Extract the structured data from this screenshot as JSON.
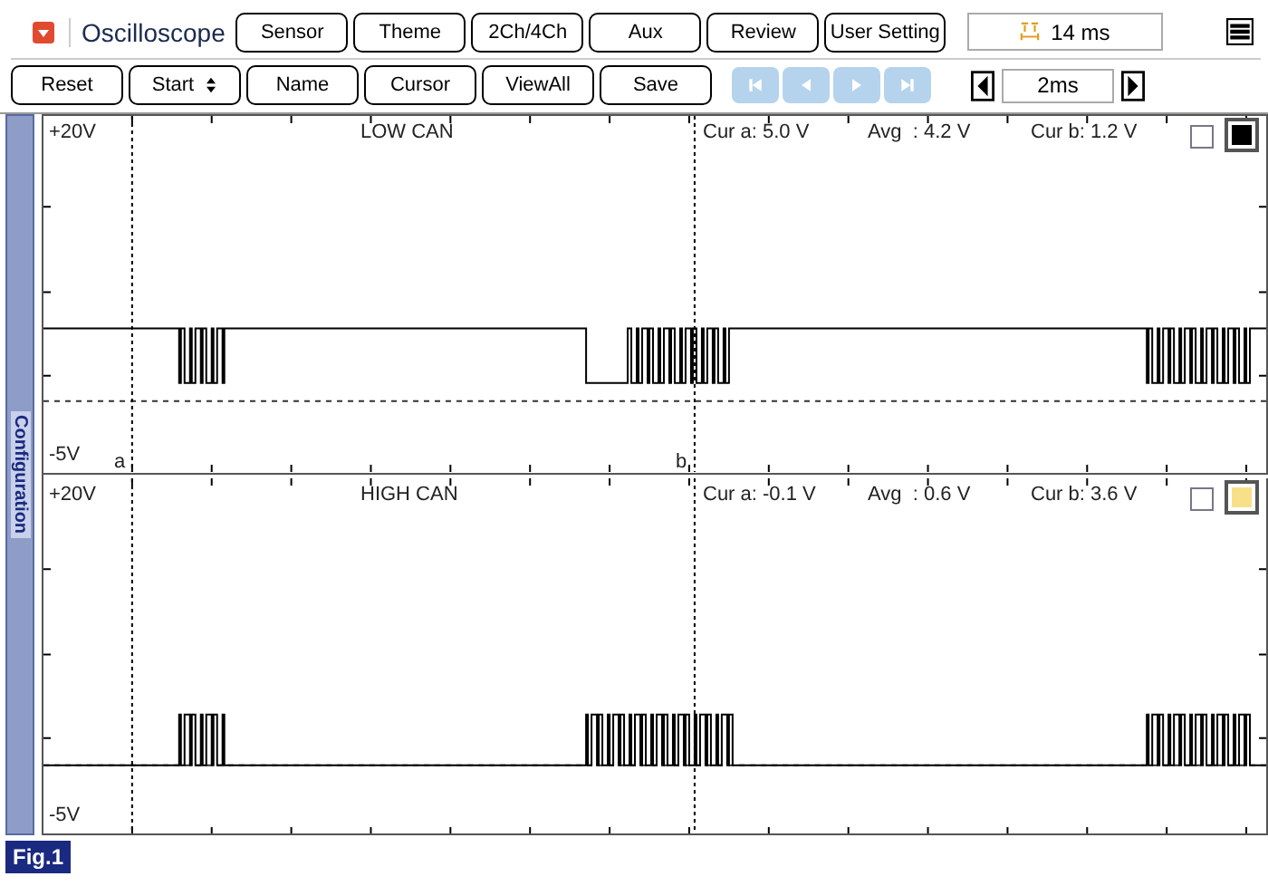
{
  "title": "Oscilloscope",
  "top_buttons": [
    "Sensor",
    "Theme",
    "2Ch/4Ch",
    "Aux",
    "Review",
    "User Setting"
  ],
  "time_readout": "14 ms",
  "action_buttons": [
    {
      "label": "Reset",
      "kind": "plain"
    },
    {
      "label": "Start",
      "kind": "spinner"
    },
    {
      "label": "Name",
      "kind": "plain"
    },
    {
      "label": "Cursor",
      "kind": "plain"
    },
    {
      "label": "ViewAll",
      "kind": "plain"
    },
    {
      "label": "Save",
      "kind": "plain"
    }
  ],
  "nav_buttons": [
    {
      "kind": "first",
      "disabled": true
    },
    {
      "kind": "prev",
      "disabled": true
    },
    {
      "kind": "next",
      "disabled": true
    },
    {
      "kind": "last",
      "disabled": true
    }
  ],
  "timebase": "2ms",
  "sidebar_tab": "Configuration",
  "channels": [
    {
      "name": "LOW CAN",
      "kind": "low",
      "top_label": "+20V",
      "bottom_label": "-5V",
      "cur_a": "Cur a: 5.0 V",
      "avg": "Avg  : 4.2 V",
      "cur_b": "Cur b: 1.2 V",
      "checked": false,
      "color": "#000000",
      "cursor_a_label": "a",
      "cursor_b_label": "b"
    },
    {
      "name": "HIGH CAN",
      "kind": "high",
      "top_label": "+20V",
      "bottom_label": "-5V",
      "cur_a": "Cur a: -0.1 V",
      "avg": "Avg  : 0.6 V",
      "cur_b": "Cur b: 3.6 V",
      "checked": false,
      "color": "#f8e08a"
    }
  ],
  "figure_label": "Fig.1"
}
